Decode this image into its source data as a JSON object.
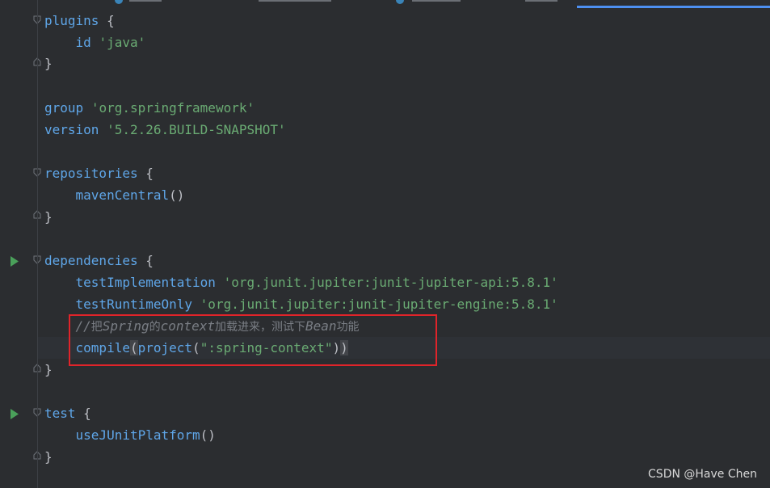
{
  "editor": {
    "lines": {
      "plugins_kw": "plugins",
      "plugins_open": " {",
      "id_kw": "id",
      "id_val": "'java'",
      "close1": "}",
      "group_kw": "group",
      "group_val": "'org.springframework'",
      "version_kw": "version",
      "version_val": "'5.2.26.BUILD-SNAPSHOT'",
      "repos_kw": "repositories",
      "repos_open": " {",
      "maven_fn": "mavenCentral",
      "maven_args": "()",
      "close2": "}",
      "deps_kw": "dependencies",
      "deps_open": " {",
      "testimpl_kw": "testImplementation",
      "testimpl_val": "'org.junit.jupiter:junit-jupiter-api:5.8.1'",
      "testrt_kw": "testRuntimeOnly",
      "testrt_val": "'org.junit.jupiter:junit-jupiter-engine:5.8.1'",
      "comment_a": "//",
      "comment_b": "把",
      "comment_c": "Spring",
      "comment_d": "的",
      "comment_e": "context",
      "comment_f": "加载进来，测试下",
      "comment_g": "Bean",
      "comment_h": "功能",
      "compile_fn": "compile",
      "paren_open": "(",
      "project_fn": "project",
      "project_open": "(",
      "project_val": "\":spring-context\"",
      "project_close": ")",
      "paren_close": ")",
      "close3": "}",
      "test_kw": "test",
      "test_open": " {",
      "junit_fn": "useJUnitPlatform",
      "junit_args": "()",
      "close4": "}"
    }
  },
  "watermark": "CSDN @Have Chen",
  "colors": {
    "background": "#2b2d30",
    "keyword": "#5fa6e8",
    "string": "#6aab73",
    "comment": "#7a7e85",
    "text": "#bcbec4",
    "highlight_box": "#e0242a",
    "run_icon": "#4aa05a",
    "tab_accent": "#4d8ff0"
  },
  "icons": {
    "run": "run-icon",
    "fold": "fold-icon"
  }
}
